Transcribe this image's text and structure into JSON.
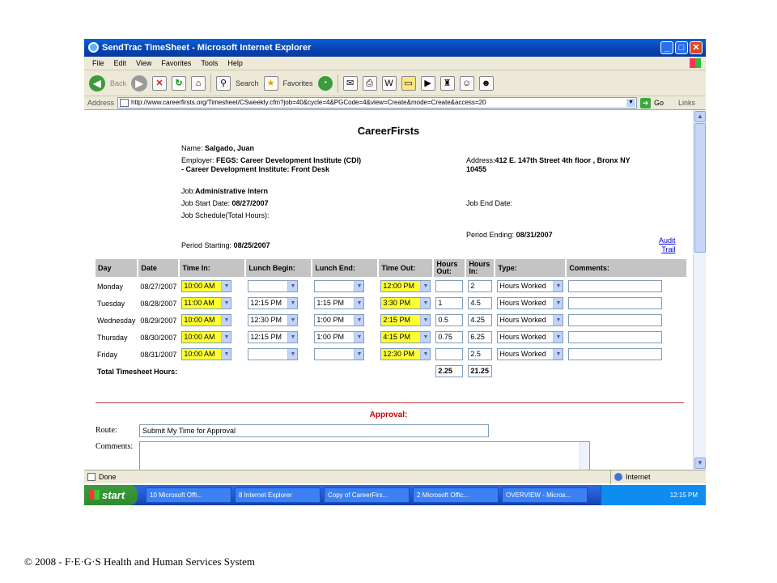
{
  "window": {
    "title": "SendTrac TimeSheet - Microsoft Internet Explorer",
    "buttons": {
      "minimize": "_",
      "maximize": "□",
      "close": "✕"
    }
  },
  "menu": [
    "File",
    "Edit",
    "View",
    "Favorites",
    "Tools",
    "Help"
  ],
  "toolbar": {
    "back": "Back",
    "search": "Search",
    "favorites": "Favorites"
  },
  "address": {
    "label": "Address",
    "url": "http://www.careerfirsts.org/Timesheet/CSweekly.cfm?job=40&cycle=4&PGCode=4&view=Create&mode=Create&access=20",
    "go": "Go",
    "links": "Links"
  },
  "page": {
    "brand": "CareerFirsts",
    "name_label": "Name:",
    "name": "Salgado, Juan",
    "employer_label": "Employer:",
    "employer_line1": "FEGS: Career Development Institute (CDI)",
    "employer_line2": "- Career Development Institute: Front Desk",
    "address_label": "Address:",
    "address_line1": "412 E. 147th Street 4th floor , Bronx NY",
    "address_line2": "10455",
    "job_label": "Job:",
    "job": "Administrative Intern",
    "start_label": "Job Start Date:",
    "start_date": "08/27/2007",
    "end_label": "Job End Date:",
    "schedule_label": "Job Schedule(Total Hours):",
    "period_start_label": "Period Starting:",
    "period_start": "08/25/2007",
    "period_end_label": "Period Ending:",
    "period_end": "08/31/2007",
    "audit_line1": "Audit",
    "audit_line2": "Trail"
  },
  "table": {
    "headers": {
      "day": "Day",
      "date": "Date",
      "time_in": "Time In:",
      "lunch_begin": "Lunch Begin:",
      "lunch_end": "Lunch End:",
      "time_out": "Time Out:",
      "hours_out": "Hours Out:",
      "hours_in": "Hours In:",
      "type": "Type:",
      "comments": "Comments:"
    },
    "rows": [
      {
        "day": "Monday",
        "date": "08/27/2007",
        "time_in": "10:00 AM",
        "lunch_begin": "",
        "lunch_end": "",
        "time_out": "12:00 PM",
        "hours_out": "",
        "hours_in": "2",
        "type": "Hours Worked",
        "comments": ""
      },
      {
        "day": "Tuesday",
        "date": "08/28/2007",
        "time_in": "11:00 AM",
        "lunch_begin": "12:15 PM",
        "lunch_end": "1:15 PM",
        "time_out": "3:30 PM",
        "hours_out": "1",
        "hours_in": "4.5",
        "type": "Hours Worked",
        "comments": ""
      },
      {
        "day": "Wednesday",
        "date": "08/29/2007",
        "time_in": "10:00 AM",
        "lunch_begin": "12:30 PM",
        "lunch_end": "1:00 PM",
        "time_out": "2:15 PM",
        "hours_out": "0.5",
        "hours_in": "4.25",
        "type": "Hours Worked",
        "comments": ""
      },
      {
        "day": "Thursday",
        "date": "08/30/2007",
        "time_in": "10:00 AM",
        "lunch_begin": "12:15 PM",
        "lunch_end": "1:00 PM",
        "time_out": "4:15 PM",
        "hours_out": "0.75",
        "hours_in": "6.25",
        "type": "Hours Worked",
        "comments": ""
      },
      {
        "day": "Friday",
        "date": "08/31/2007",
        "time_in": "10:00 AM",
        "lunch_begin": "",
        "lunch_end": "",
        "time_out": "12:30 PM",
        "hours_out": "",
        "hours_in": "2.5",
        "type": "Hours Worked",
        "comments": ""
      }
    ],
    "total_label": "Total Timesheet Hours:",
    "total_out": "2.25",
    "total_in": "21.25"
  },
  "approval": {
    "heading": "Approval:",
    "route_label": "Route:",
    "route_value": "Submit My Time for Approval",
    "comments_label": "Comments:"
  },
  "status": {
    "left": "Done",
    "zone": "Internet"
  },
  "taskbar": {
    "start": "start",
    "tasks": [
      "10 Microsoft Offi...",
      "8 Internet Explorer",
      "Copy of CareerFirs...",
      "2 Microsoft Offic...",
      "OVERVIEW - Micros..."
    ],
    "clock": "12:15 PM"
  },
  "footer": "© 2008 - F·E·G·S Health and Human Services System",
  "colors": {
    "highlight": "#ffff33",
    "titlebar": "#0842b0",
    "approval": "#cc0000"
  }
}
